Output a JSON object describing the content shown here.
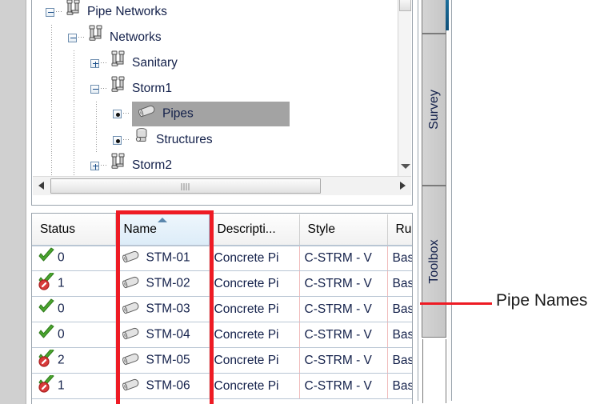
{
  "tree": {
    "name": "Pipe Networks Tree",
    "items": [
      {
        "label": "Pipe Networks",
        "indent": 0,
        "expander": "minus",
        "icon": "pipe-network-icon",
        "selected": false
      },
      {
        "label": "Networks",
        "indent": 1,
        "expander": "minus",
        "icon": "pipe-network-icon",
        "selected": false
      },
      {
        "label": "Sanitary",
        "indent": 2,
        "expander": "plus",
        "icon": "pipe-network-icon",
        "selected": false
      },
      {
        "label": "Storm1",
        "indent": 2,
        "expander": "minus",
        "icon": "pipe-network-icon",
        "selected": false
      },
      {
        "label": "Pipes",
        "indent": 3,
        "expander": "dot",
        "icon": "pipe-icon",
        "selected": true
      },
      {
        "label": "Structures",
        "indent": 3,
        "expander": "dot",
        "icon": "structure-icon",
        "selected": false
      },
      {
        "label": "Storm2",
        "indent": 2,
        "expander": "plus",
        "icon": "pipe-network-icon",
        "selected": false
      }
    ],
    "vscrollbar": "vertical-scrollbar",
    "hscrollbar": "horizontal-scrollbar"
  },
  "table": {
    "name": "pipes-data-grid",
    "columns": [
      {
        "label": "Status",
        "key": "status",
        "sorted": false
      },
      {
        "label": "Name",
        "key": "name",
        "sorted": true
      },
      {
        "label": "Descripti...",
        "key": "description",
        "sorted": false
      },
      {
        "label": "Style",
        "key": "style",
        "sorted": false
      },
      {
        "label": "Ru",
        "key": "rule",
        "sorted": false
      }
    ],
    "rows": [
      {
        "status_count": "0",
        "status_state": "ok",
        "name": "STM-01",
        "description": "Concrete Pi",
        "style": "C-STRM - V",
        "rule": "Bas"
      },
      {
        "status_count": "1",
        "status_state": "warning",
        "name": "STM-02",
        "description": "Concrete Pi",
        "style": "C-STRM - V",
        "rule": "Bas"
      },
      {
        "status_count": "0",
        "status_state": "ok",
        "name": "STM-03",
        "description": "Concrete Pi",
        "style": "C-STRM - V",
        "rule": "Bas"
      },
      {
        "status_count": "0",
        "status_state": "ok",
        "name": "STM-04",
        "description": "Concrete Pi",
        "style": "C-STRM - V",
        "rule": "Bas"
      },
      {
        "status_count": "2",
        "status_state": "warning",
        "name": "STM-05",
        "description": "Concrete Pi",
        "style": "C-STRM - V",
        "rule": "Bas"
      },
      {
        "status_count": "1",
        "status_state": "warning",
        "name": "STM-06",
        "description": "Concrete Pi",
        "style": "C-STRM - V",
        "rule": "Bas"
      }
    ]
  },
  "side_tabs": [
    {
      "label": "Survey"
    },
    {
      "label": "Toolbox"
    }
  ],
  "annotation": {
    "label": "Pipe Names",
    "highlight_color": "#ee1b24"
  },
  "colors": {
    "selection": "#a3a3a3",
    "sorted_header": "#dcecf8",
    "grid_line": "#b9c6d4",
    "text": "#13204a",
    "accent_red": "#ee1b24",
    "check_green": "#3f9a33"
  }
}
